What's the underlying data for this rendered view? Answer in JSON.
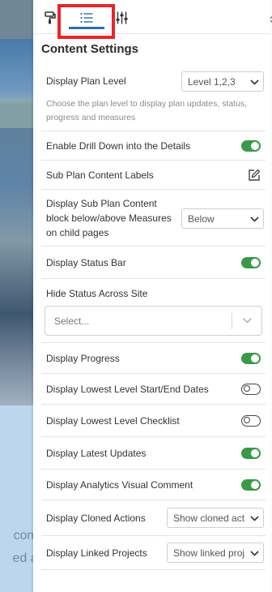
{
  "background": {
    "text_line_1": "comm",
    "text_line_2": "ed a d",
    "close_glyph": "×"
  },
  "panel": {
    "title": "Content Settings",
    "tabs": [
      {
        "icon": "paint-roller-icon",
        "active": false
      },
      {
        "icon": "list-icon",
        "active": true
      },
      {
        "icon": "sliders-icon",
        "active": false
      }
    ],
    "display_plan_level": {
      "label": "Display Plan Level",
      "value": "Level 1,2,3",
      "help": "Choose the plan level to display plan updates, status, progress and measures"
    },
    "enable_drill_down": {
      "label": "Enable Drill Down into the Details",
      "on": true
    },
    "sub_plan_content_labels": {
      "label": "Sub Plan Content Labels"
    },
    "sub_plan_content_block": {
      "label_lines": [
        "Display Sub Plan Content",
        "block below/above Measures",
        "on child pages"
      ],
      "value": "Below"
    },
    "display_status_bar": {
      "label": "Display Status Bar",
      "on": true
    },
    "hide_status_across_site": {
      "label": "Hide Status Across Site",
      "placeholder": "Select..."
    },
    "display_progress": {
      "label": "Display Progress",
      "on": true
    },
    "display_lowest_level_dates": {
      "label": "Display Lowest Level Start/End Dates",
      "on": false
    },
    "display_lowest_level_checklist": {
      "label": "Display Lowest Level Checklist",
      "on": false
    },
    "display_latest_updates": {
      "label": "Display Latest Updates",
      "on": true
    },
    "display_analytics_visual_comment": {
      "label": "Display Analytics Visual Comment",
      "on": true
    },
    "display_cloned_actions": {
      "label": "Display Cloned Actions",
      "value": "Show cloned act"
    },
    "display_linked_projects": {
      "label": "Display Linked Projects",
      "value": "Show linked proj"
    }
  },
  "colors": {
    "accent": "#2f6fa8",
    "toggle_on": "#3a9a4a",
    "highlight": "#e8262b"
  }
}
